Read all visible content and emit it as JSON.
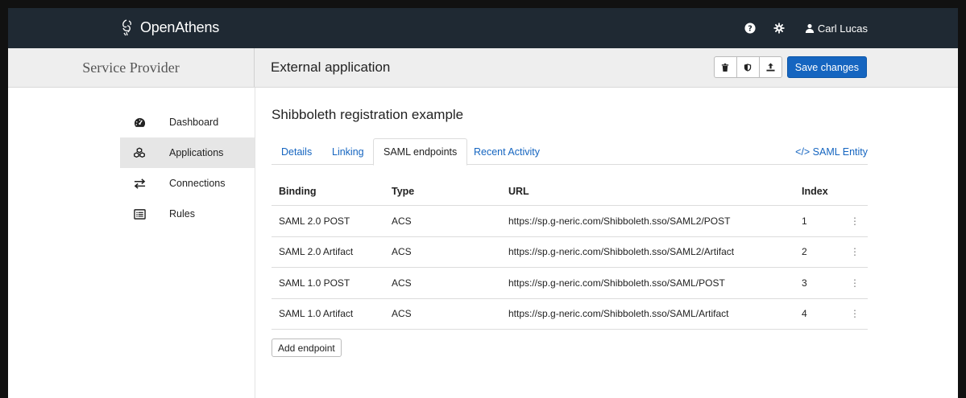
{
  "topbar": {
    "brand": "OpenAthens",
    "help_icon": "question-circle-icon",
    "settings_icon": "gear-icon",
    "user_icon": "user-icon",
    "user_name": "Carl Lucas"
  },
  "header": {
    "section_title": "Service Provider",
    "page_title": "External application",
    "toolbar": {
      "delete_icon": "trash-icon",
      "shield_icon": "shield-icon",
      "upload_icon": "upload-icon",
      "save_label": "Save changes"
    }
  },
  "sidebar": {
    "items": [
      {
        "label": "Dashboard",
        "icon": "dashboard-gauge-icon",
        "active": false
      },
      {
        "label": "Applications",
        "icon": "cubes-icon",
        "active": true
      },
      {
        "label": "Connections",
        "icon": "exchange-arrows-icon",
        "active": false
      },
      {
        "label": "Rules",
        "icon": "list-icon",
        "active": false
      }
    ]
  },
  "main": {
    "title": "Shibboleth registration example",
    "tabs": [
      {
        "label": "Details",
        "active": false
      },
      {
        "label": "Linking",
        "active": false
      },
      {
        "label": "SAML endpoints",
        "active": true
      },
      {
        "label": "Recent Activity",
        "active": false
      }
    ],
    "saml_entity_link": "</> SAML Entity",
    "table": {
      "headers": {
        "binding": "Binding",
        "type": "Type",
        "url": "URL",
        "index": "Index"
      },
      "rows": [
        {
          "binding": "SAML 2.0 POST",
          "type": "ACS",
          "url": "https://sp.g-neric.com/Shibboleth.sso/SAML2/POST",
          "index": "1"
        },
        {
          "binding": "SAML 2.0 Artifact",
          "type": "ACS",
          "url": "https://sp.g-neric.com/Shibboleth.sso/SAML2/Artifact",
          "index": "2"
        },
        {
          "binding": "SAML 1.0 POST",
          "type": "ACS",
          "url": "https://sp.g-neric.com/Shibboleth.sso/SAML/POST",
          "index": "3"
        },
        {
          "binding": "SAML 1.0 Artifact",
          "type": "ACS",
          "url": "https://sp.g-neric.com/Shibboleth.sso/SAML/Artifact",
          "index": "4"
        }
      ]
    },
    "add_endpoint_label": "Add endpoint"
  },
  "colors": {
    "topbar_bg": "#1f2933",
    "accent": "#1565c0",
    "header_bg": "#eeeeee"
  }
}
